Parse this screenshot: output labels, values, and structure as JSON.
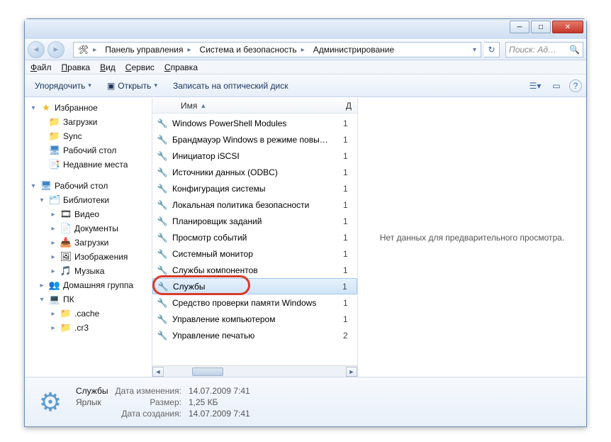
{
  "titlebar": {
    "min": "─",
    "max": "□",
    "close": "✕"
  },
  "nav": {
    "back": "◄",
    "fwd": "►",
    "crumbs": [
      "Панель управления",
      "Система и безопасность",
      "Администрирование"
    ],
    "refresh": "↻",
    "search_placeholder": "Поиск: Ад…",
    "mag": "🔍"
  },
  "menu": {
    "file": "Файл",
    "edit": "Правка",
    "view": "Вид",
    "tools": "Сервис",
    "help": "Справка"
  },
  "toolbar": {
    "organize": "Упорядочить",
    "open": "Открыть",
    "burn": "Записать на оптический диск",
    "dd": "▾",
    "view_ico": "☰",
    "preview_ico": "▭",
    "help_ico": "?"
  },
  "tree": {
    "favorites": "Избранное",
    "fav_items": [
      "Загрузки",
      "Sync",
      "Рабочий стол",
      "Недавние места"
    ],
    "desktop": "Рабочий стол",
    "libraries": "Библиотеки",
    "lib_items": [
      "Видео",
      "Документы",
      "Загрузки",
      "Изображения",
      "Музыка"
    ],
    "homegroup": "Домашняя группа",
    "pc": "ПК",
    "pc_items": [
      ".cache",
      ".cr3"
    ]
  },
  "columns": {
    "name": "Имя",
    "date": "Д"
  },
  "items": [
    {
      "name": "Windows PowerShell Modules",
      "d": "1"
    },
    {
      "name": "Брандмауэр Windows в режиме повы…",
      "d": "1"
    },
    {
      "name": "Инициатор iSCSI",
      "d": "1"
    },
    {
      "name": "Источники данных (ODBC)",
      "d": "1"
    },
    {
      "name": "Конфигурация системы",
      "d": "1"
    },
    {
      "name": "Локальная политика безопасности",
      "d": "1"
    },
    {
      "name": "Планировщик заданий",
      "d": "1"
    },
    {
      "name": "Просмотр событий",
      "d": "1"
    },
    {
      "name": "Системный монитор",
      "d": "1"
    },
    {
      "name": "Службы компонентов",
      "d": "1"
    },
    {
      "name": "Службы",
      "d": "1",
      "selected": true,
      "highlight": true
    },
    {
      "name": "Средство проверки памяти Windows",
      "d": "1"
    },
    {
      "name": "Управление компьютером",
      "d": "1"
    },
    {
      "name": "Управление печатью",
      "d": "2"
    }
  ],
  "preview": {
    "empty": "Нет данных для предварительного просмотра."
  },
  "details": {
    "name": "Службы",
    "type": "Ярлык",
    "modified_lbl": "Дата изменения:",
    "modified": "14.07.2009 7:41",
    "size_lbl": "Размер:",
    "size": "1,25 КБ",
    "created_lbl": "Дата создания:",
    "created": "14.07.2009 7:41"
  }
}
